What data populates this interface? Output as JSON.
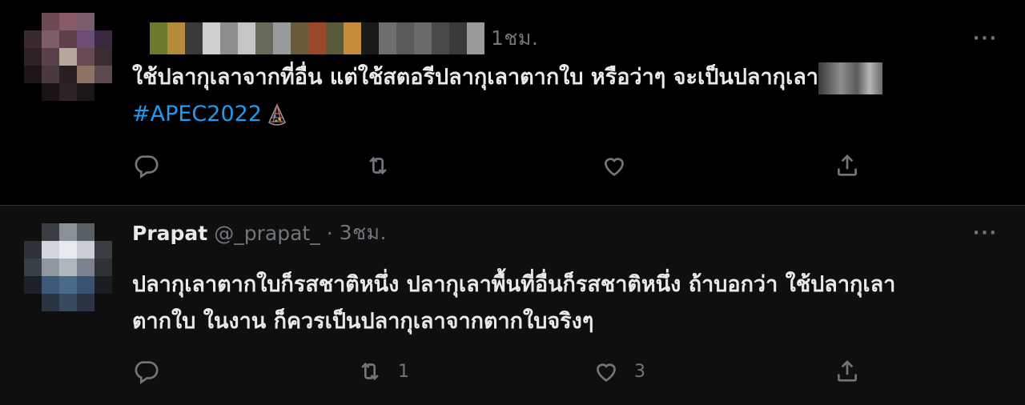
{
  "tweets": [
    {
      "author_name": "",
      "handle": "",
      "time": "1ชม.",
      "more": "···",
      "line1": "ใช้ปลากุเลาจากที่อื่น แต่ใช้สตอรีปลากุเลาตากใบ หรือว่าๆ จะเป็นปลากุเลา",
      "hashtag": "#APEC2022",
      "reply_count": "",
      "retweet_count": "",
      "like_count": ""
    },
    {
      "author_name": "Prapat",
      "handle": "@_prapat_",
      "dot": "·",
      "time": "3ชม.",
      "more": "···",
      "line1": "ปลากุเลาตากใบก็รสชาติหนึ่ง ปลากุเลาพื้นที่อื่นก็รสชาติหนึ่ง ถ้าบอกว่า ใช้ปลากุเลา",
      "line2": "ตากใบ ในงาน ก็ควรเป็นปลากุเลาจากตากใบจริงๆ",
      "reply_count": "",
      "retweet_count": "1",
      "like_count": "3"
    }
  ],
  "icons": {
    "reply": "reply-icon",
    "retweet": "retweet-icon",
    "like": "heart-icon",
    "share": "share-icon",
    "more": "more-icon"
  },
  "colors": {
    "background": "#000000",
    "reply_background": "#0f0f0f",
    "text": "#e7e9ea",
    "secondary": "#71767b",
    "link": "#1d9bf0",
    "divider": "#2f3336"
  }
}
